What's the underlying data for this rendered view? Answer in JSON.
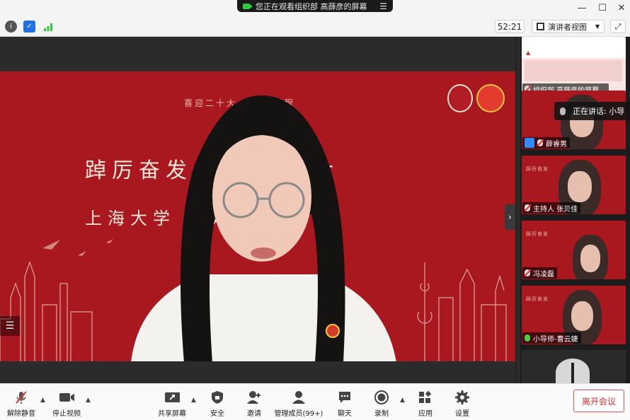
{
  "banner": {
    "text": "您正在观看组织部 高薛彦的屏幕",
    "menu_icon": "menu-icon"
  },
  "window": {
    "minimize": "—",
    "maximize": "☐",
    "close": "✕"
  },
  "toolbar": {
    "timer": "52:21",
    "view_label": "演讲者视图",
    "icons": [
      "info-icon",
      "shield-icon",
      "signal-icon",
      "fullscreen-icon"
    ]
  },
  "main_video": {
    "bg_line1": "喜迎二十大 奋进新征程",
    "bg_line2": "踔厉奋发 喜迎二十大",
    "bg_line3": "上海大学 系列活动"
  },
  "side_handle": "›",
  "participants": [
    {
      "name": "组织部 高薛彦的屏幕...",
      "muted": true,
      "type": "screen"
    },
    {
      "name": "薛睿男",
      "muted": true,
      "type": "avatar"
    },
    {
      "name": "主持人 张贝佳",
      "muted": true,
      "type": "video"
    },
    {
      "name": "冯凌磊",
      "muted": true,
      "type": "video"
    },
    {
      "name": "小导师-曹云婕",
      "muted": false,
      "type": "video"
    }
  ],
  "speaking": {
    "label": "正在讲话: 小导"
  },
  "bottom": {
    "unmute": "解除静音",
    "stop_video": "停止视频",
    "share_screen": "共享屏幕",
    "security": "安全",
    "invite": "邀请",
    "manage": "管理成员(99+)",
    "chat": "聊天",
    "record": "录制",
    "apps": "应用",
    "settings": "设置",
    "leave": "离开会议"
  },
  "colors": {
    "accent_red": "#a9171f",
    "leave_red": "#e03030",
    "zoom_blue": "#2d8cff"
  }
}
